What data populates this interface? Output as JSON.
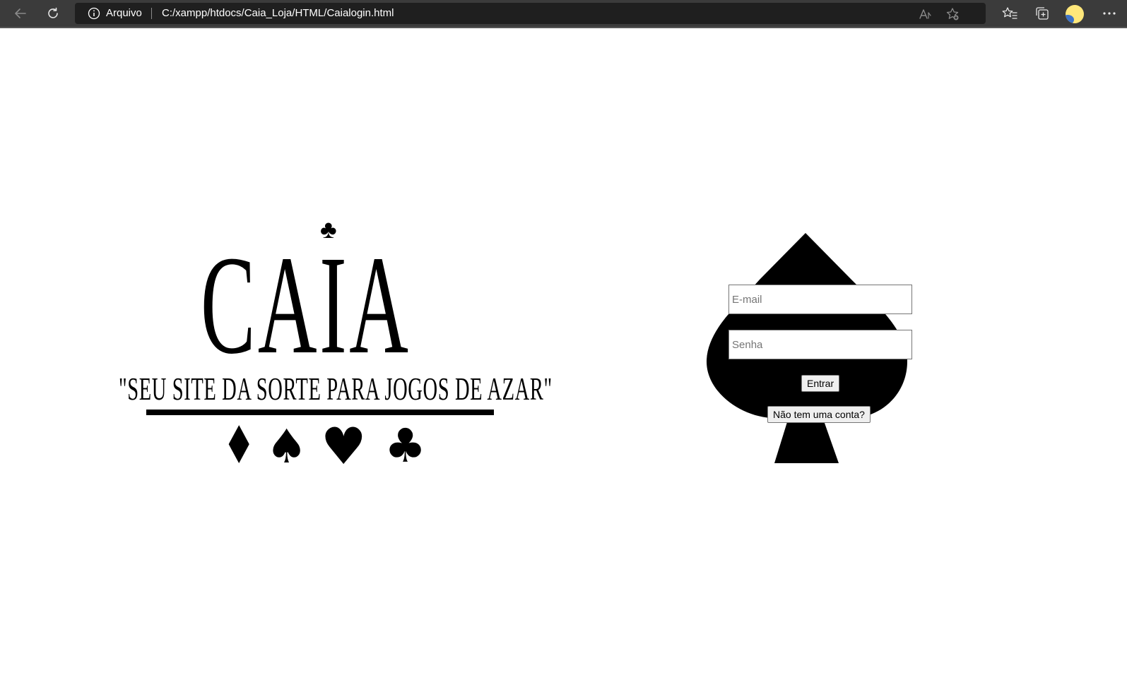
{
  "browser": {
    "address_protocol": "Arquivo",
    "address_url": "C:/xampp/htdocs/Caia_Loja/HTML/Caialogin.html",
    "icons": [
      "back-icon",
      "refresh-icon",
      "info-icon",
      "read-aloud-icon",
      "add-favorite-icon",
      "favorites-icon",
      "collections-icon",
      "profile-avatar",
      "more-options-icon"
    ]
  },
  "logo": {
    "title": "CAIA",
    "tagline": "\"SEU SITE DA SORTE PARA JOGOS DE AZAR\"",
    "top_suit": "♣",
    "suits": [
      "♦",
      "♠",
      "♥",
      "♣"
    ]
  },
  "login": {
    "email_placeholder": "E-mail",
    "password_placeholder": "Senha",
    "submit_label": "Entrar",
    "signup_label": "Não tem uma conta?"
  },
  "colors": {
    "chrome_bg": "#3b3b3b",
    "address_bg": "#1f1f1f",
    "page_bg": "#ffffff",
    "logo_ink": "#000000",
    "avatar": "#ffe77a"
  }
}
